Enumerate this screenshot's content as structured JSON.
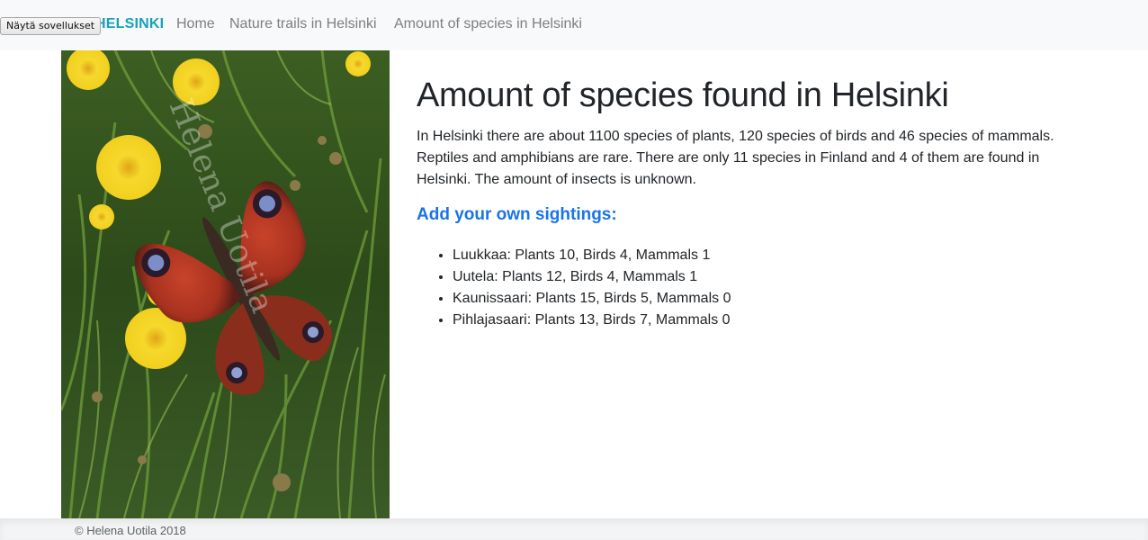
{
  "system": {
    "tooltip_label": "Näytä sovellukset"
  },
  "navbar": {
    "brand": "HELSINKI",
    "links": [
      {
        "label": "Home"
      },
      {
        "label": "Nature trails in Helsinki"
      },
      {
        "label": "Amount of species in Helsinki"
      }
    ],
    "brand_color": "#17a2b8"
  },
  "photo": {
    "watermark": "Helena Uotila"
  },
  "main": {
    "title": "Amount of species found in Helsinki",
    "intro": "In Helsinki there are about 1100 species of plants, 120 species of birds and 46 species of mammals. Reptiles and amphibians are rare. There are only 11 species in Finland and 4 of them are found in Helsinki. The amount of insects is unknown.",
    "subheading": "Add your own sightings:",
    "subheading_color": "#1a73e8",
    "sightings": [
      {
        "text": "Luukkaa: Plants 10, Birds 4, Mammals 1"
      },
      {
        "text": "Uutela: Plants 12, Birds 4, Mammals 1"
      },
      {
        "text": "Kaunissaari: Plants 15, Birds 5, Mammals 0"
      },
      {
        "text": "Pihlajasaari: Plants 13, Birds 7, Mammals 0"
      }
    ]
  },
  "footer": {
    "copyright": "© Helena Uotila 2018"
  }
}
